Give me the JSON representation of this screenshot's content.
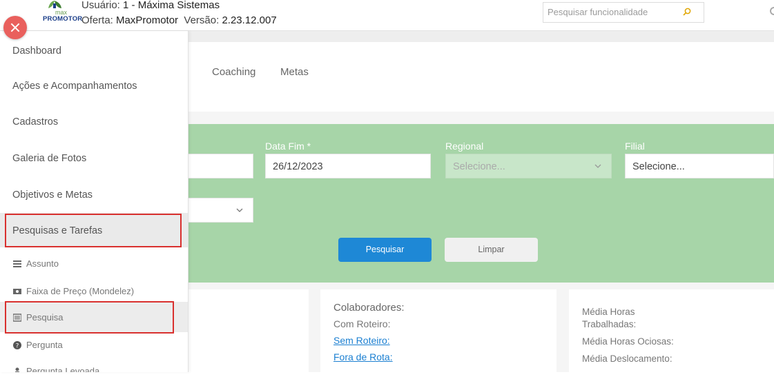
{
  "header": {
    "logo_small": "max",
    "logo_brand": "PROMOTOR",
    "user_label": "Usuário:",
    "user_value": "1 - Máxima Sistemas",
    "offer_label": "Oferta:",
    "offer_value": "MaxPromotor",
    "version_label": "Versão:",
    "version_value": "2.23.12.007",
    "search_placeholder": "Pesquisar funcionalidade"
  },
  "tabs": [
    "Coaching",
    "Metas"
  ],
  "filters": {
    "date_end_label": "Data Fim *",
    "date_end_value": "26/12/2023",
    "regional_label": "Regional",
    "regional_placeholder": "Selecione...",
    "filial_label": "Filial",
    "filial_placeholder": "Selecione...",
    "search_button": "Pesquisar",
    "clear_button": "Limpar"
  },
  "cards": {
    "collaborators_title": "Colaboradores:",
    "with_route": "Com Roteiro:",
    "without_route": "Sem Roteiro:",
    "off_route": "Fora de Rota:",
    "avg_hours_worked_1": "Média Horas",
    "avg_hours_worked_2": "Trabalhadas:",
    "avg_idle_hours": "Média Horas Ociosas:",
    "avg_travel": "Média Deslocamento:"
  },
  "sidebar": {
    "items": [
      {
        "label": "Dashboard"
      },
      {
        "label": "Ações e Acompanhamentos"
      },
      {
        "label": "Cadastros"
      },
      {
        "label": "Galeria de Fotos"
      },
      {
        "label": "Objetivos e Metas"
      },
      {
        "label": "Pesquisas e Tarefas"
      }
    ],
    "subitems": [
      {
        "label": "Assunto",
        "icon": "list-icon"
      },
      {
        "label": "Faixa de Preço (Mondelez)",
        "icon": "money-icon"
      },
      {
        "label": "Pesquisa",
        "icon": "form-icon"
      },
      {
        "label": "Pergunta",
        "icon": "question-icon"
      },
      {
        "label": "Pergunta Levoada",
        "icon": "person-icon"
      }
    ]
  },
  "colors": {
    "filter_panel": "#a7d5a8",
    "primary_button": "#1e88d6",
    "link": "#1a7fd1",
    "highlight": "#d9302e",
    "close_button": "#e9605d"
  }
}
